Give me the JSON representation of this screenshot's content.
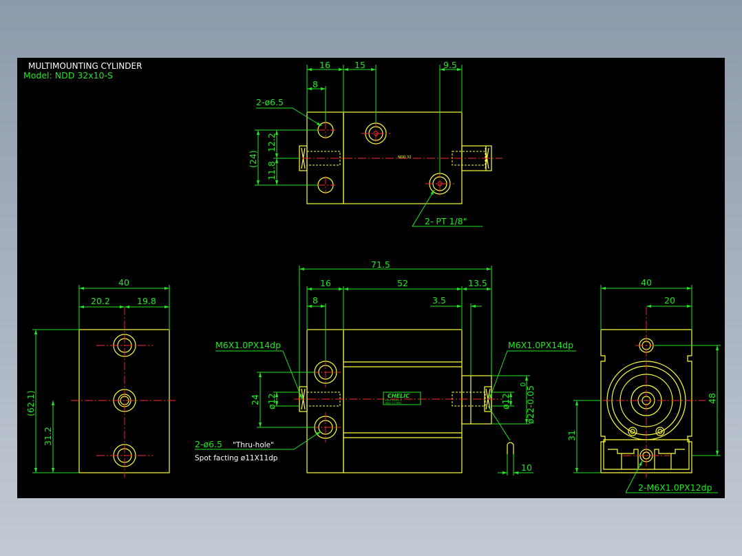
{
  "title": "MULTIMOUNTING CYLINDER",
  "model": "Model:  NDD  32x10-S",
  "colors": {
    "background": "#000000",
    "outline": "#ffff3f",
    "dimension": "#22e622",
    "centerline": "#ff2a2a",
    "window": "#8d9aab"
  },
  "top_view": {
    "dims": {
      "d16": "16",
      "d15": "15",
      "d8": "8",
      "d9_5": "9.5",
      "d24": "(24)",
      "d12_2": "12.2",
      "d11_8": "11.8"
    },
    "callouts": {
      "holes": "2-ø6.5",
      "port": "2-  PT 1/8\""
    },
    "tiny_label": "NDD 32"
  },
  "front_view": {
    "dims": {
      "d71_5": "71.5",
      "d16": "16",
      "d52": "52",
      "d13_5": "13.5",
      "d8": "8",
      "d3_5": "3.5",
      "d24": "24",
      "d12a": "ø12",
      "d12b": "ø12",
      "d22": "ø22-0.05",
      "d22_tol": "0",
      "d10": "10"
    },
    "callouts": {
      "thread_left": "M6X1.0PX14dp",
      "thread_right": "M6X1.0PX14dp",
      "thru_hole": "2-ø6.5",
      "thru_hole_note": "\"Thru-hole\"",
      "spot_facing": "Spot facting  ø11X11dp"
    },
    "nameplate": {
      "brand": "CHELIC",
      "line1": "NDD  32x10-S",
      "line2": "MAX 1.0 MPa"
    }
  },
  "left_view": {
    "dims": {
      "d40": "40",
      "d20_2": "20.2",
      "d19_8": "19.8",
      "d62_1": "(62.1)",
      "d31_2": "31.2"
    }
  },
  "right_view": {
    "dims": {
      "d40": "40",
      "d20": "20",
      "d48": "48",
      "d31": "31"
    },
    "callouts": {
      "thread": "2-M6X1.0PX12dp"
    }
  }
}
